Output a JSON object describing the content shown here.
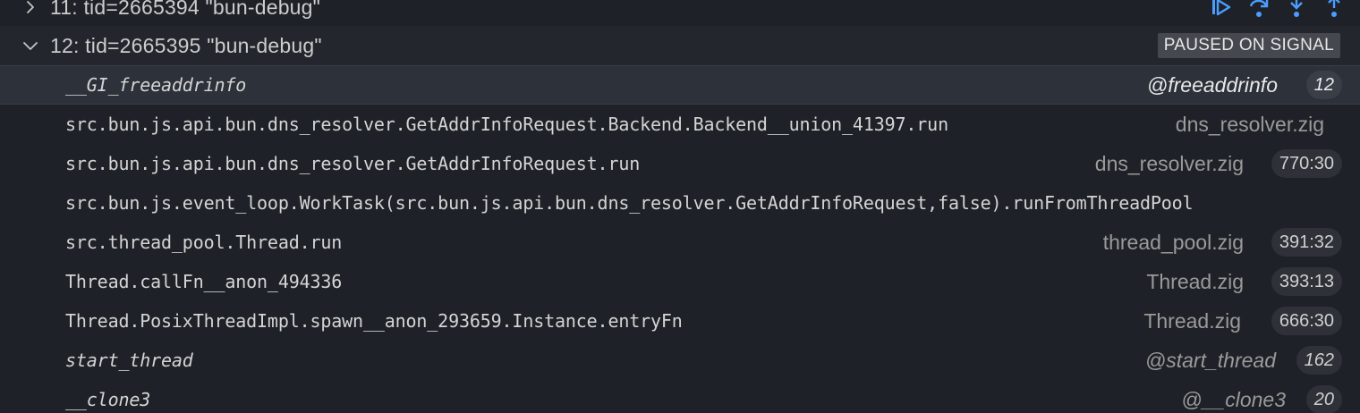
{
  "threads": [
    {
      "label": "11: tid=2665394 \"bun-debug\"",
      "expanded": false
    },
    {
      "label": "12: tid=2665395 \"bun-debug\"",
      "expanded": true,
      "status": "PAUSED ON SIGNAL"
    }
  ],
  "toolbar_icons": [
    "continue-icon",
    "step-over-icon",
    "step-into-icon",
    "step-out-icon"
  ],
  "colors": {
    "background": "#1e2127",
    "selected_row": "#2d3139",
    "accent": "#4a9eff",
    "badge": "#45484f"
  },
  "frames": [
    {
      "name": "__GI_freeaddrinfo",
      "file": "@freeaddrinfo",
      "line": "12",
      "italic": true,
      "selected": true
    },
    {
      "name": "src.bun.js.api.bun.dns_resolver.GetAddrInfoRequest.Backend.Backend__union_41397.run",
      "file": "dns_resolver.zig",
      "line": "",
      "italic": false,
      "selected": false
    },
    {
      "name": "src.bun.js.api.bun.dns_resolver.GetAddrInfoRequest.run",
      "file": "dns_resolver.zig",
      "line": "770:30",
      "italic": false,
      "selected": false
    },
    {
      "name": "src.bun.js.event_loop.WorkTask(src.bun.js.api.bun.dns_resolver.GetAddrInfoRequest,false).runFromThreadPool",
      "file": "",
      "line": "",
      "italic": false,
      "selected": false
    },
    {
      "name": "src.thread_pool.Thread.run",
      "file": "thread_pool.zig",
      "line": "391:32",
      "italic": false,
      "selected": false
    },
    {
      "name": "Thread.callFn__anon_494336",
      "file": "Thread.zig",
      "line": "393:13",
      "italic": false,
      "selected": false
    },
    {
      "name": "Thread.PosixThreadImpl.spawn__anon_293659.Instance.entryFn",
      "file": "Thread.zig",
      "line": "666:30",
      "italic": false,
      "selected": false
    },
    {
      "name": "start_thread",
      "file": "@start_thread",
      "line": "162",
      "italic": true,
      "selected": false
    },
    {
      "name": "__clone3",
      "file": "@__clone3",
      "line": "20",
      "italic": true,
      "selected": false
    }
  ]
}
